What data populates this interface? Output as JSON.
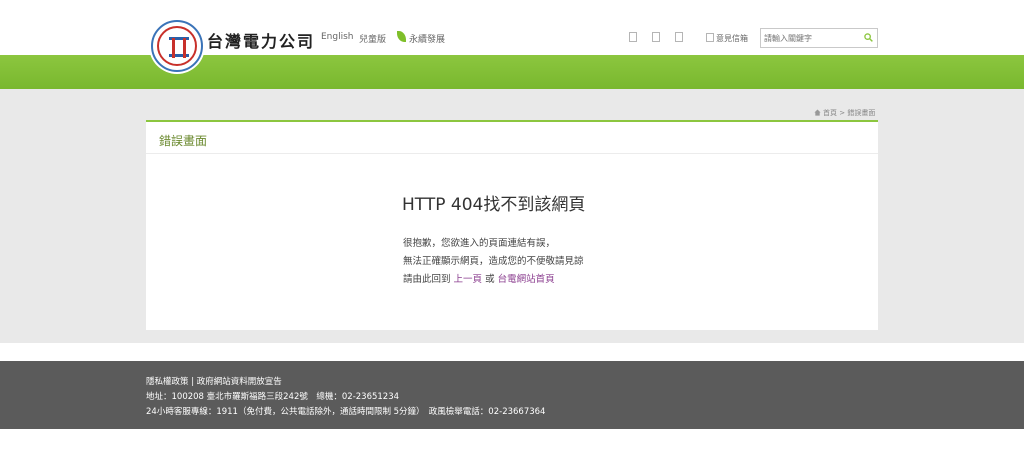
{
  "header": {
    "brand": "台灣電力公司",
    "nav": {
      "english": "English",
      "kids": "兒童版",
      "sustainability": "永續發展"
    },
    "feedback_label": "意見信箱",
    "search": {
      "placeholder": "請輸入關鍵字"
    }
  },
  "breadcrumb": {
    "home": "首頁",
    "separator": ">",
    "current": "錯誤畫面"
  },
  "card": {
    "title": "錯誤畫面",
    "error_title": "HTTP 404找不到該網頁",
    "line1": "很抱歉，您欲進入的頁面連結有誤，",
    "line2": "無法正確顯示網頁，造成您的不便敬請見諒",
    "line3_prefix": "請由此回到",
    "back_link": "上一頁",
    "or": "或",
    "home_link": "台電網站首頁"
  },
  "footer": {
    "privacy": "隱私權政策",
    "sep": "|",
    "open_data": "政府網站資料開放宣告",
    "address": "地址：100208 臺北市羅斯福路三段242號　總機：02-23651234",
    "hotline": "24小時客服專線：1911（免付費，公共電話除外，通話時間限制 5分鐘）　政風檢舉電話：02-23667364"
  },
  "colors": {
    "green": "#8cc63f",
    "title_green": "#6b8a2f",
    "link_purple": "#8b3e8f",
    "footer_bg": "#5b5b5b"
  }
}
